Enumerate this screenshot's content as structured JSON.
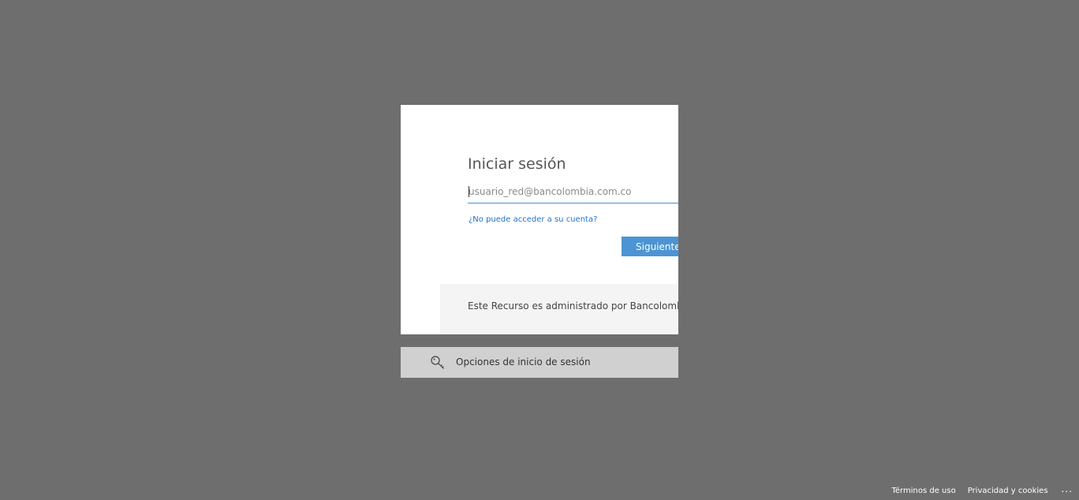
{
  "signin": {
    "title": "Iniciar sesión",
    "email_placeholder": "usuario_red@bancolombia.com.co",
    "email_value": "",
    "cant_access_link": "¿No puede acceder a su cuenta?",
    "next_button": "Siguiente",
    "admin_notice": "Este Recurso es administrado por Bancolombia S.A."
  },
  "options": {
    "label": "Opciones de inicio de sesión",
    "icon": "key-icon"
  },
  "footer": {
    "terms": "Términos de uso",
    "privacy": "Privacidad y cookies",
    "more": "..."
  },
  "colors": {
    "background": "#6e6e6e",
    "accent": "#4c94d4",
    "link": "#2672c8"
  }
}
